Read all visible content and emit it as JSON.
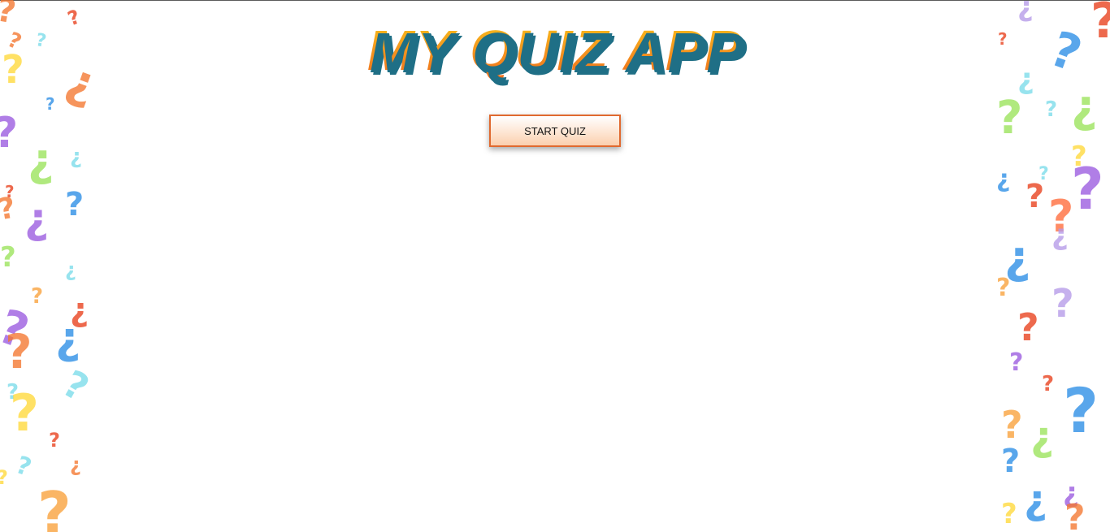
{
  "app": {
    "title": "MY QUIZ APP"
  },
  "actions": {
    "start_label": "START QUIZ"
  },
  "theme": {
    "title_gradient": [
      "#f6c21a",
      "#f59a1e",
      "#ef6a1c"
    ],
    "title_shadow": "#1f6f86",
    "button_border": "#e0692f",
    "button_fill": "#fde3cf"
  },
  "decoration": {
    "icon": "question-mark-icon",
    "palette": [
      "#f4772f",
      "#e8401c",
      "#f9a13a",
      "#ffd93b",
      "#9be35a",
      "#7adcea",
      "#2b8ee6",
      "#9b5be0",
      "#b59ae8",
      "#ff6b3a"
    ]
  }
}
